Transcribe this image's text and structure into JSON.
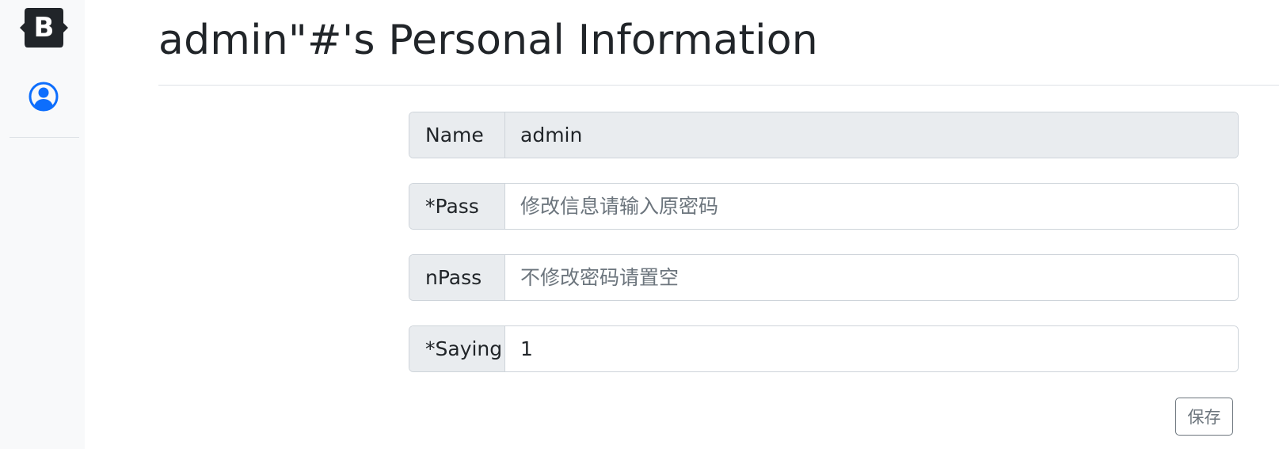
{
  "sidebar": {
    "brand_letter": "B",
    "brand_icon": "bootstrap-logo",
    "user_icon": "person-circle-icon",
    "accent_color": "#0d6efd"
  },
  "page": {
    "title": "admin\"#'s Personal Information"
  },
  "form": {
    "name": {
      "label": "Name",
      "value": "admin",
      "placeholder": ""
    },
    "pass": {
      "label": "*Pass",
      "value": "",
      "placeholder": "修改信息请输入原密码"
    },
    "npass": {
      "label": "nPass",
      "value": "",
      "placeholder": "不修改密码请置空"
    },
    "saying": {
      "label": "*Saying",
      "value": "1",
      "placeholder": ""
    },
    "save_label": "保存"
  }
}
